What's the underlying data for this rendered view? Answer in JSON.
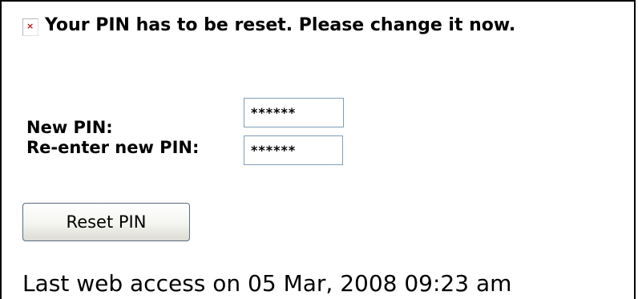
{
  "notice": {
    "icon": "broken-image-icon",
    "icon_color": "#d01010",
    "message": "Your PIN has to be reset. Please change it now."
  },
  "form": {
    "new_pin_label": "New PIN:",
    "new_pin_value": "******",
    "reenter_pin_label": "Re-enter new PIN:",
    "reenter_pin_value": "******",
    "submit_label": "Reset PIN"
  },
  "footer": {
    "last_access": "Last web access on 05 Mar, 2008 09:23 am"
  }
}
